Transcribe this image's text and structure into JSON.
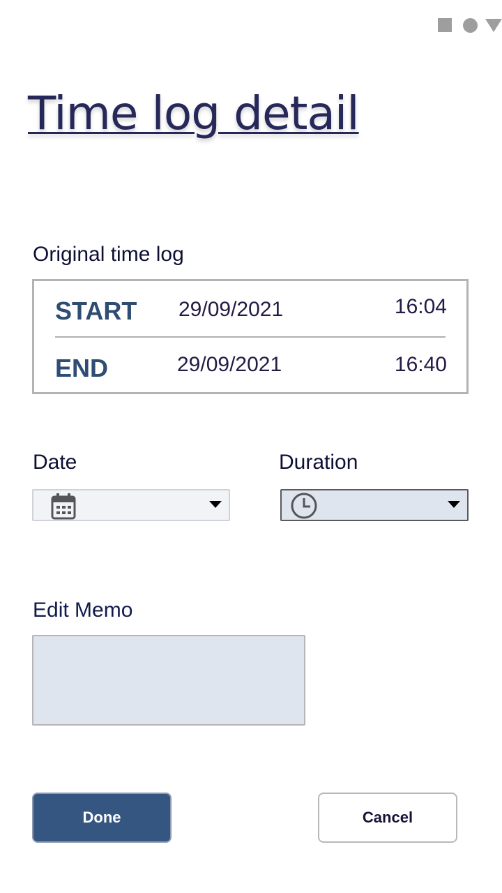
{
  "status_bar": {
    "icons": [
      "square-icon",
      "circle-icon",
      "triangle-icon"
    ]
  },
  "page": {
    "title": "Time log detail"
  },
  "original_log": {
    "label": "Original time log",
    "start": {
      "keyword": "START",
      "date": "29/09/2021",
      "time": "16:04"
    },
    "end": {
      "keyword": "END",
      "date": "29/09/2021",
      "time": "16:40"
    }
  },
  "date_field": {
    "label": "Date",
    "icon": "calendar-icon",
    "value": ""
  },
  "duration_field": {
    "label": "Duration",
    "icon": "clock-icon",
    "value": ""
  },
  "memo": {
    "label": "Edit Memo",
    "value": ""
  },
  "actions": {
    "done_label": "Done",
    "cancel_label": "Cancel"
  },
  "colors": {
    "title": "#27285a",
    "keyword": "#2f4c73",
    "primary_button": "#355680",
    "input_fill": "#dfe5ee"
  }
}
